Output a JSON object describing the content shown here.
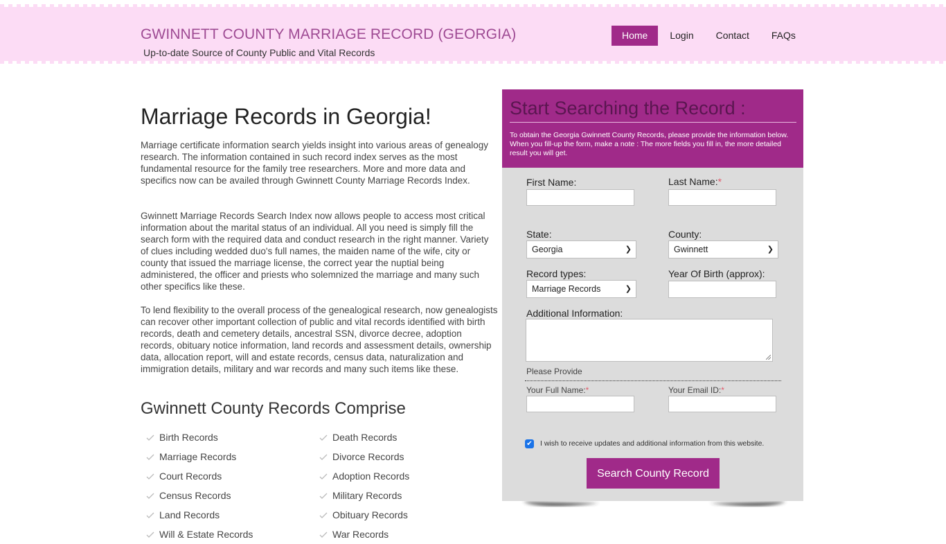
{
  "header": {
    "site_title": "GWINNETT COUNTY MARRIAGE RECORD (GEORGIA)",
    "tagline": "Up-to-date Source of  County Public and Vital Records",
    "nav": [
      {
        "label": "Home",
        "active": true
      },
      {
        "label": "Login",
        "active": false
      },
      {
        "label": "Contact",
        "active": false
      },
      {
        "label": "FAQs",
        "active": false
      }
    ]
  },
  "main": {
    "title": "Marriage Records in Georgia!",
    "paragraphs": [
      "Marriage certificate information search yields insight into various areas of genealogy research. The information contained in such record index serves as the most fundamental resource for the family tree researchers. More and more data and specifics now can be availed through Gwinnett County Marriage Records Index.",
      "Gwinnett Marriage Records Search Index now allows people to access most critical information about the marital status of an individual. All you need is simply fill the search form with the required data and conduct research in the right manner. Variety of clues including wedded duo's full names, the maiden name of the wife, city or county that issued the marriage license, the correct year the nuptial being administered, the officer and priests who solemnized the marriage and many such other specifics like these.",
      "To lend flexibility to the overall process of the genealogical research, now genealogists can recover other important collection of public and vital records identified with birth records, death and cemetery details, ancestral SSN, divorce decree, adoption records, obituary notice information, land records and assessment details, ownership data, allocation report, will and estate records, census data, naturalization and immigration details, military and war records and many such items like these."
    ],
    "records_title": "Gwinnett County Records Comprise",
    "records": [
      "Birth Records",
      "Death Records",
      "Marriage Records",
      "Divorce Records",
      "Court Records",
      "Adoption Records",
      "Census Records",
      "Military Records",
      "Land Records",
      "Obituary Records",
      "Will & Estate Records",
      "War Records"
    ]
  },
  "form": {
    "title": "Start Searching the Record :",
    "description": "To obtain the Georgia Gwinnett County Records, please provide the information below. When you fill-up the form, make a note : The more fields you fill in, the more detailed result you will get.",
    "first_name_label": "First Name:",
    "first_name_value": "",
    "last_name_label": "Last Name:",
    "last_name_value": "",
    "required_mark": "*",
    "state_label": "State:",
    "state_value": "Georgia",
    "county_label": "County:",
    "county_value": "Gwinnett",
    "record_types_label": "Record types:",
    "record_types_value": "Marriage Records",
    "yob_label": "Year Of Birth (approx):",
    "yob_value": "",
    "additional_label": "Additional Information:",
    "additional_value": "",
    "please_provide": "Please Provide",
    "full_name_label": "Your Full Name:",
    "full_name_value": "",
    "email_label": "Your Email ID:",
    "email_value": "",
    "updates_checked": true,
    "updates_label": "I wish to receive updates and additional information from this website.",
    "submit_label": "Search County Record"
  },
  "colors": {
    "accent": "#a02a89",
    "header_bg": "#fcdcf5",
    "panel_bg": "#dcdcdc",
    "required": "#e05a6a"
  }
}
